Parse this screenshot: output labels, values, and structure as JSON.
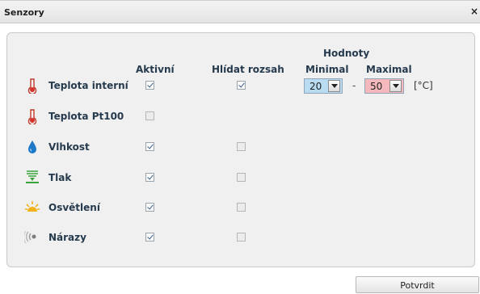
{
  "dialog": {
    "title": "Senzory",
    "close_label": "×"
  },
  "columns": {
    "active": "Aktivní",
    "watch_range": "Hlídat rozsah",
    "values_group": "Hodnoty",
    "min": "Minimal",
    "max": "Maximal"
  },
  "sensors": [
    {
      "label": "Teplota interní",
      "icon": "thermometer-icon",
      "active": true,
      "watch_range": true
    },
    {
      "label": "Teplota Pt100",
      "icon": "thermometer-icon",
      "active": false,
      "watch_range": null
    },
    {
      "label": "Vlhkost",
      "icon": "water-drop-icon",
      "active": true,
      "watch_range": false
    },
    {
      "label": "Tlak",
      "icon": "pressure-icon",
      "active": true,
      "watch_range": false
    },
    {
      "label": "Osvětlení",
      "icon": "sun-icon",
      "active": true,
      "watch_range": false
    },
    {
      "label": "Nárazy",
      "icon": "vibration-icon",
      "active": true,
      "watch_range": false
    }
  ],
  "range": {
    "min_value": "20",
    "separator": "-",
    "max_value": "50",
    "unit": "[°C]"
  },
  "colors": {
    "min_select": "#b9dcf3",
    "max_select": "#f4b8bd",
    "label_text": "#263a4e"
  },
  "footer": {
    "confirm_label": "Potvrdit"
  }
}
